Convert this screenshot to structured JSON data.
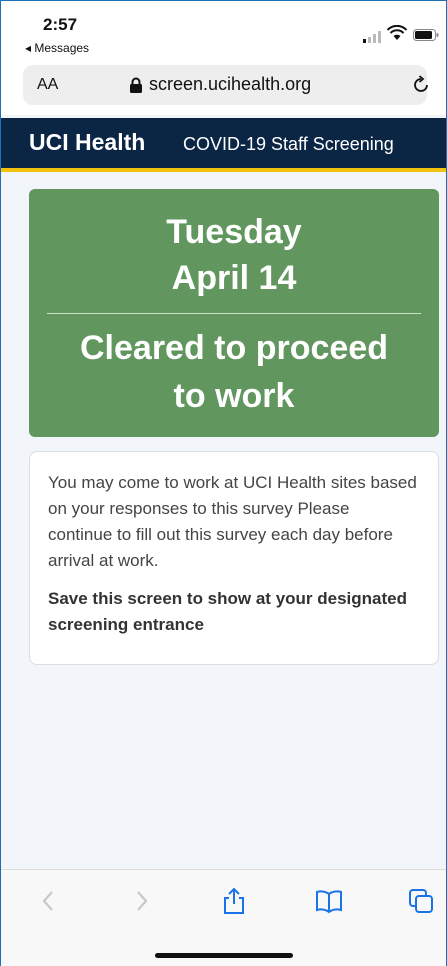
{
  "status": {
    "time": "2:57",
    "back_app": "◂ Messages"
  },
  "browser": {
    "aa_label": "AA",
    "url": "screen.ucihealth.org"
  },
  "header": {
    "brand": "UCI Health",
    "subtitle": "COVID-19 Staff Screening"
  },
  "result": {
    "day": "Tuesday",
    "date": "April 14",
    "status_line1": "Cleared to proceed",
    "status_line2": "to work",
    "color": "#62965f"
  },
  "info": {
    "message": "You may come to work at UCI Health sites based on your responses to this survey Please continue to fill out this survey each day before arrival at work.",
    "save_note": "Save this screen to show at your designated screening entrance"
  },
  "icons": [
    "signal-icon",
    "wifi-icon",
    "battery-icon",
    "lock-icon",
    "reload-icon",
    "back-icon",
    "forward-icon",
    "share-icon",
    "bookmarks-icon",
    "tabs-icon"
  ]
}
